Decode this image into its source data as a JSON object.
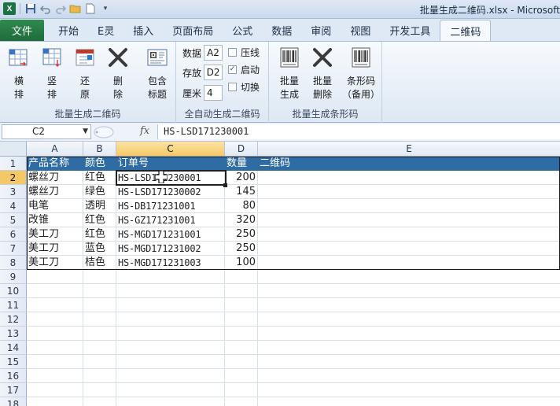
{
  "window": {
    "title": "批量生成二维码.xlsx - Microsoft"
  },
  "qat_icons": [
    "excel-logo-icon",
    "save-icon",
    "undo-icon",
    "redo-icon",
    "open-folder-icon",
    "new-document-icon",
    "customize-qat-icon"
  ],
  "ribbon_tabs": [
    {
      "label": "文件",
      "active": false
    },
    {
      "label": "开始",
      "active": false
    },
    {
      "label": "E灵",
      "active": false
    },
    {
      "label": "插入",
      "active": false
    },
    {
      "label": "页面布局",
      "active": false
    },
    {
      "label": "公式",
      "active": false
    },
    {
      "label": "数据",
      "active": false
    },
    {
      "label": "审阅",
      "active": false
    },
    {
      "label": "视图",
      "active": false
    },
    {
      "label": "开发工具",
      "active": false
    },
    {
      "label": "二维码",
      "active": true
    }
  ],
  "ribbon": {
    "group1": {
      "label": "批量生成二维码",
      "buttons": [
        {
          "label": "横\n排",
          "icon": "horizontal-layout-icon"
        },
        {
          "label": "竖\n排",
          "icon": "vertical-layout-icon"
        },
        {
          "label": "还\n原",
          "icon": "restore-icon"
        },
        {
          "label": "删\n除",
          "icon": "delete-x-icon"
        },
        {
          "label": "包含\n标题",
          "icon": "include-title-icon"
        }
      ]
    },
    "group2": {
      "label": "全自动生成二维码",
      "data_label": "数据",
      "data_value": "A2",
      "store_label": "存放",
      "store_value": "D2",
      "cm_label": "厘米",
      "cm_value": "4",
      "checks": [
        {
          "label": "压线",
          "checked": false
        },
        {
          "label": "启动",
          "checked": true
        },
        {
          "label": "切换",
          "checked": false
        }
      ]
    },
    "group3": {
      "label": "批量生成条形码",
      "buttons": [
        {
          "label": "批量\n生成",
          "icon": "barcode-generate-icon"
        },
        {
          "label": "批量\n删除",
          "icon": "delete-x-icon"
        },
        {
          "label": "条形码\n（备用）",
          "icon": "barcode-backup-icon"
        }
      ]
    }
  },
  "formula_bar": {
    "name_box": "C2",
    "fx_label": "fx",
    "content": "HS-LSD171230001"
  },
  "sheet": {
    "columns": [
      "A",
      "B",
      "C",
      "D",
      "E"
    ],
    "selected_column": "C",
    "row_numbers": [
      "1",
      "2",
      "3",
      "4",
      "5",
      "6",
      "7",
      "8",
      "9",
      "10",
      "11",
      "12",
      "13",
      "14",
      "15",
      "16",
      "17",
      "18"
    ],
    "selected_row": "2",
    "header": [
      "产品名称",
      "颜色",
      "订单号",
      "数量",
      "二维码"
    ],
    "rows": [
      [
        "螺丝刀",
        "红色",
        "HS-LSD171230001",
        "200"
      ],
      [
        "螺丝刀",
        "绿色",
        "HS-LSD171230002",
        "145"
      ],
      [
        "电笔",
        "透明",
        "HS-DB171231001",
        "80"
      ],
      [
        "改锥",
        "红色",
        "HS-GZ171231001",
        "320"
      ],
      [
        "美工刀",
        "红色",
        "HS-MGD171231001",
        "250"
      ],
      [
        "美工刀",
        "蓝色",
        "HS-MGD171231002",
        "250"
      ],
      [
        "美工刀",
        "桔色",
        "HS-MGD171231003",
        "100"
      ]
    ]
  },
  "colors": {
    "table_header_bg": "#2f6ca4",
    "file_tab": "#1f6b3a",
    "selected_header": "#f5c867"
  }
}
